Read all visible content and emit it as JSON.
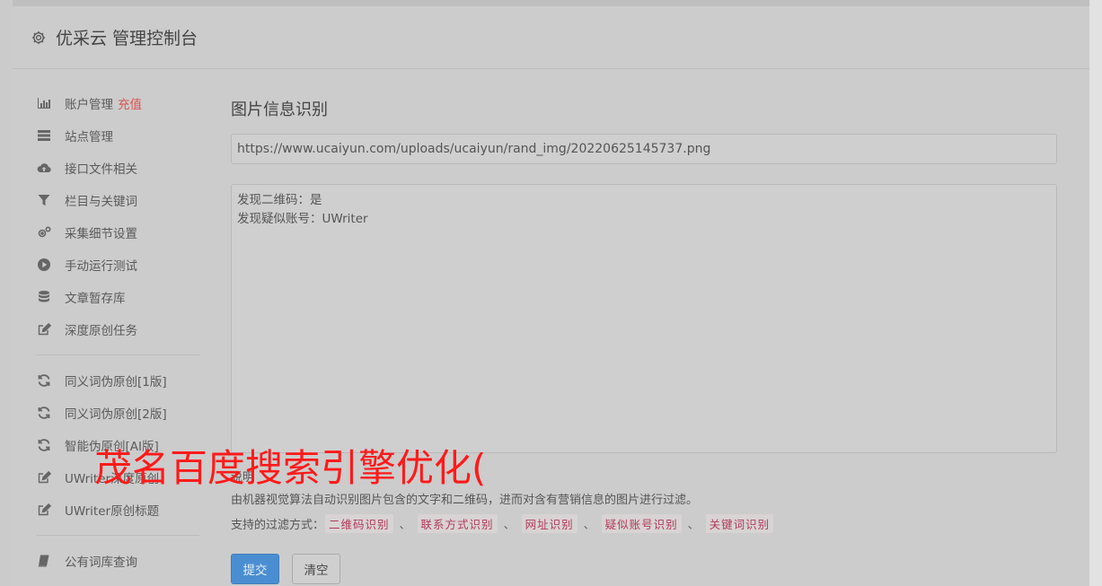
{
  "header": {
    "title": "优采云 管理控制台"
  },
  "sidebar": {
    "group1": [
      {
        "label": "账户管理",
        "badge": "充值",
        "icon": "bar-chart-icon"
      },
      {
        "label": "站点管理",
        "icon": "server-icon"
      },
      {
        "label": "接口文件相关",
        "icon": "cloud-upload-icon"
      },
      {
        "label": "栏目与关键词",
        "icon": "filter-icon"
      },
      {
        "label": "采集细节设置",
        "icon": "cogs-icon"
      },
      {
        "label": "手动运行测试",
        "icon": "play-circle-icon"
      },
      {
        "label": "文章暂存库",
        "icon": "database-icon"
      },
      {
        "label": "深度原创任务",
        "icon": "edit-icon"
      }
    ],
    "group2": [
      {
        "label": "同义词伪原创[1版]",
        "icon": "refresh-icon"
      },
      {
        "label": "同义词伪原创[2版]",
        "icon": "refresh-icon"
      },
      {
        "label": "智能伪原创[AI版]",
        "icon": "refresh-icon"
      },
      {
        "label": "UWriter深度原创",
        "icon": "edit-icon"
      },
      {
        "label": "UWriter原创标题",
        "icon": "edit-icon"
      }
    ],
    "group3": [
      {
        "label": "公有词库查询",
        "icon": "book-icon"
      }
    ]
  },
  "main": {
    "title": "图片信息识别",
    "url_value": "https://www.ucaiyun.com/uploads/ucaiyun/rand_img/20220625145737.png",
    "result_lines": [
      "发现二维码：是",
      "发现疑似账号：UWriter"
    ],
    "desc_label": "说明",
    "description": "由机器视觉算法自动识别图片包含的文字和二维码，进而对含有营销信息的图片进行过滤。",
    "filter_prefix": "支持的过滤方式：",
    "filters": [
      "二维码识别",
      "联系方式识别",
      "网址识别",
      "疑似账号识别",
      "关键词识别"
    ],
    "separator": "、",
    "submit_label": "提交",
    "clear_label": "清空"
  },
  "overlay": {
    "watermark_text": "茂名百度搜索引擎优化("
  },
  "colors": {
    "primary": "#4a8ed1",
    "badge": "#d9534f",
    "tag_text": "#b33a5a",
    "watermark": "#ff1a1a"
  }
}
